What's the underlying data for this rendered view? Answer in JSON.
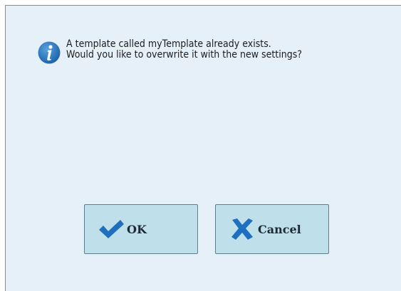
{
  "dialog": {
    "icon": "info-icon",
    "message_line1": "A template called myTemplate already exists.",
    "message_line2": "Would you like to overwrite it with the new settings?"
  },
  "buttons": {
    "ok": {
      "label": "OK",
      "icon": "checkmark-icon"
    },
    "cancel": {
      "label": "Cancel",
      "icon": "x-icon"
    }
  },
  "colors": {
    "background": "#e6f0f8",
    "button_fill": "#bfe0ea",
    "icon_blue": "#1f6fbf"
  }
}
